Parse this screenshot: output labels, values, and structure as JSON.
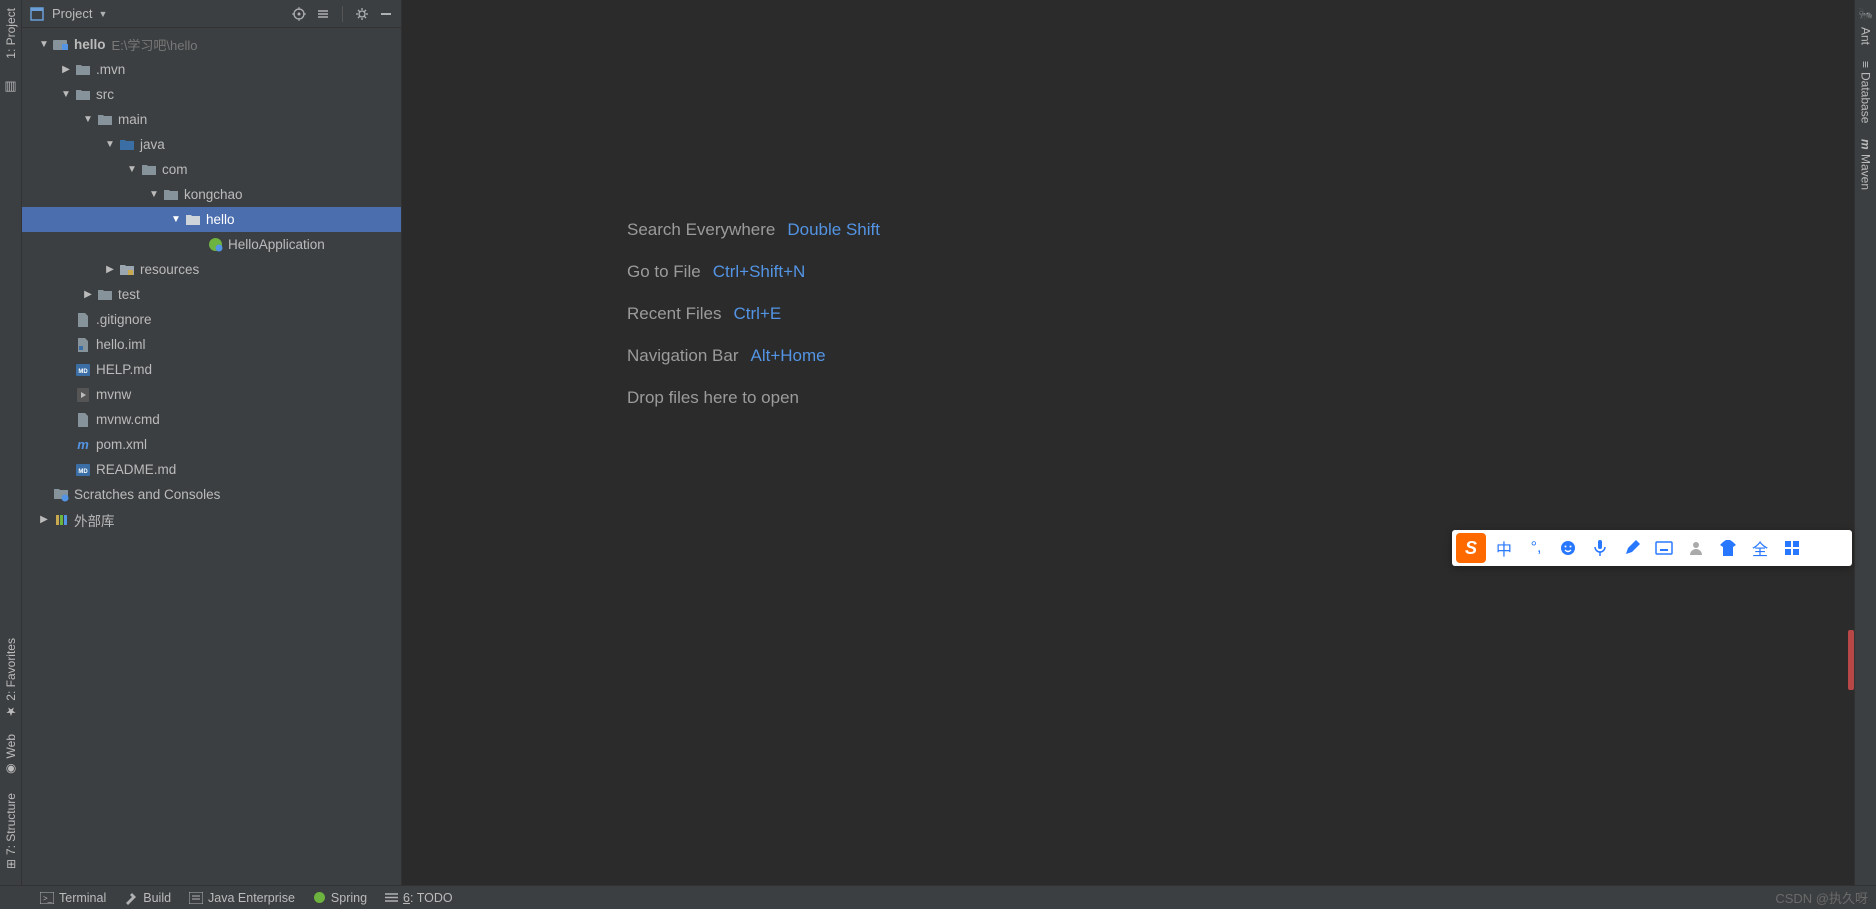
{
  "leftStrip": {
    "project": "1: Project",
    "favorites": "2: Favorites",
    "web": "Web",
    "structure": "7: Structure"
  },
  "rightStrip": {
    "ant": "Ant",
    "database": "Database",
    "maven": "Maven"
  },
  "panel": {
    "title": "Project"
  },
  "tree": {
    "root": {
      "label": "hello",
      "path": "E:\\学习吧\\hello"
    },
    "mvn": ".mvn",
    "src": "src",
    "main": "main",
    "java": "java",
    "com": "com",
    "kongchao": "kongchao",
    "helloPkg": "hello",
    "helloApp": "HelloApplication",
    "resources": "resources",
    "test": "test",
    "gitignore": ".gitignore",
    "iml": "hello.iml",
    "help": "HELP.md",
    "mvnw": "mvnw",
    "mvnwcmd": "mvnw.cmd",
    "pom": "pom.xml",
    "readme": "README.md",
    "scratches": "Scratches and Consoles",
    "external": "外部库"
  },
  "hints": {
    "search": {
      "label": "Search Everywhere",
      "key": "Double Shift"
    },
    "goto": {
      "label": "Go to File",
      "key": "Ctrl+Shift+N"
    },
    "recent": {
      "label": "Recent Files",
      "key": "Ctrl+E"
    },
    "nav": {
      "label": "Navigation Bar",
      "key": "Alt+Home"
    },
    "drop": "Drop files here to open"
  },
  "bottom": {
    "terminal": "Terminal",
    "build": "Build",
    "javaee": "Java Enterprise",
    "spring": "Spring",
    "todo_prefix": "6",
    "todo_suffix": ": TODO",
    "watermark": "CSDN @执久呀"
  },
  "ime": {
    "logo": "S",
    "zhong": "中",
    "quan": "全"
  }
}
